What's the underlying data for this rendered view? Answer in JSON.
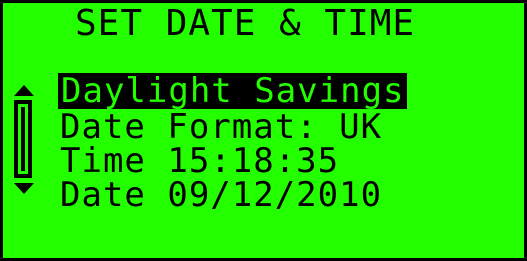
{
  "screen": {
    "title": "SET DATE & TIME",
    "background_color": "#24ff00",
    "text_color": "#000000"
  },
  "menu": {
    "items": [
      {
        "label": "Daylight Savings",
        "selected": true
      },
      {
        "label": "Date Format: UK",
        "selected": false
      },
      {
        "label": "Time 15:18:35",
        "selected": false
      },
      {
        "label": "Date 09/12/2010",
        "selected": false
      }
    ]
  },
  "scrollbar": {
    "up_icon": "triangle-up",
    "down_icon": "triangle-down"
  }
}
